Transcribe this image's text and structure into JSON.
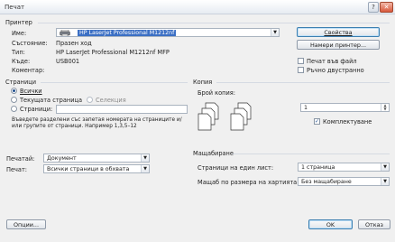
{
  "window": {
    "title": "Печат"
  },
  "printer_section": {
    "group_label": "Принтер",
    "name_label": "Име:",
    "name_value": "HP LaserJet Professional M1212nf",
    "properties_button": "Свойства",
    "status_label": "Състояние:",
    "status_value": "Празен ход",
    "type_label": "Тип:",
    "type_value": "HP LaserJet Professional M1212nf MFP",
    "where_label": "Къде:",
    "where_value": "USB001",
    "comment_label": "Коментар:",
    "find_printer_button": "Намери принтер...",
    "print_to_file_label": "Печат във файл",
    "manual_duplex_label": "Ръчно двустранно"
  },
  "page_range": {
    "group_label": "Страници",
    "all_label": "Всички",
    "current_page_label": "Текущата страница",
    "selection_label": "Селекция",
    "pages_label": "Страници:",
    "help_text": "Въведете разделени със запетая номерата на страниците и/или групите от страници. Например 1,3,5–12"
  },
  "copies": {
    "group_label": "Копия",
    "number_label": "Брой копия:",
    "number_value": "1",
    "collate_label": "Комплектуване"
  },
  "print_what": {
    "print_what_label": "Печатай:",
    "print_what_value": "Документ",
    "print_label": "Печат:",
    "print_value": "Всички страници в обхвата"
  },
  "zoom": {
    "group_label": "Мащабиране",
    "pages_per_sheet_label": "Страници на един лист:",
    "pages_per_sheet_value": "1 страница",
    "scale_label": "Мащаб по размера на хартията:",
    "scale_value": "Без мащабиране"
  },
  "footer": {
    "options_button": "Опции...",
    "ok_button": "OK",
    "cancel_button": "Отказ"
  },
  "titlebar_buttons": {
    "help": "?",
    "close": "✕"
  },
  "colors": {
    "accent": "#3b6fc4",
    "close": "#d9583b"
  }
}
